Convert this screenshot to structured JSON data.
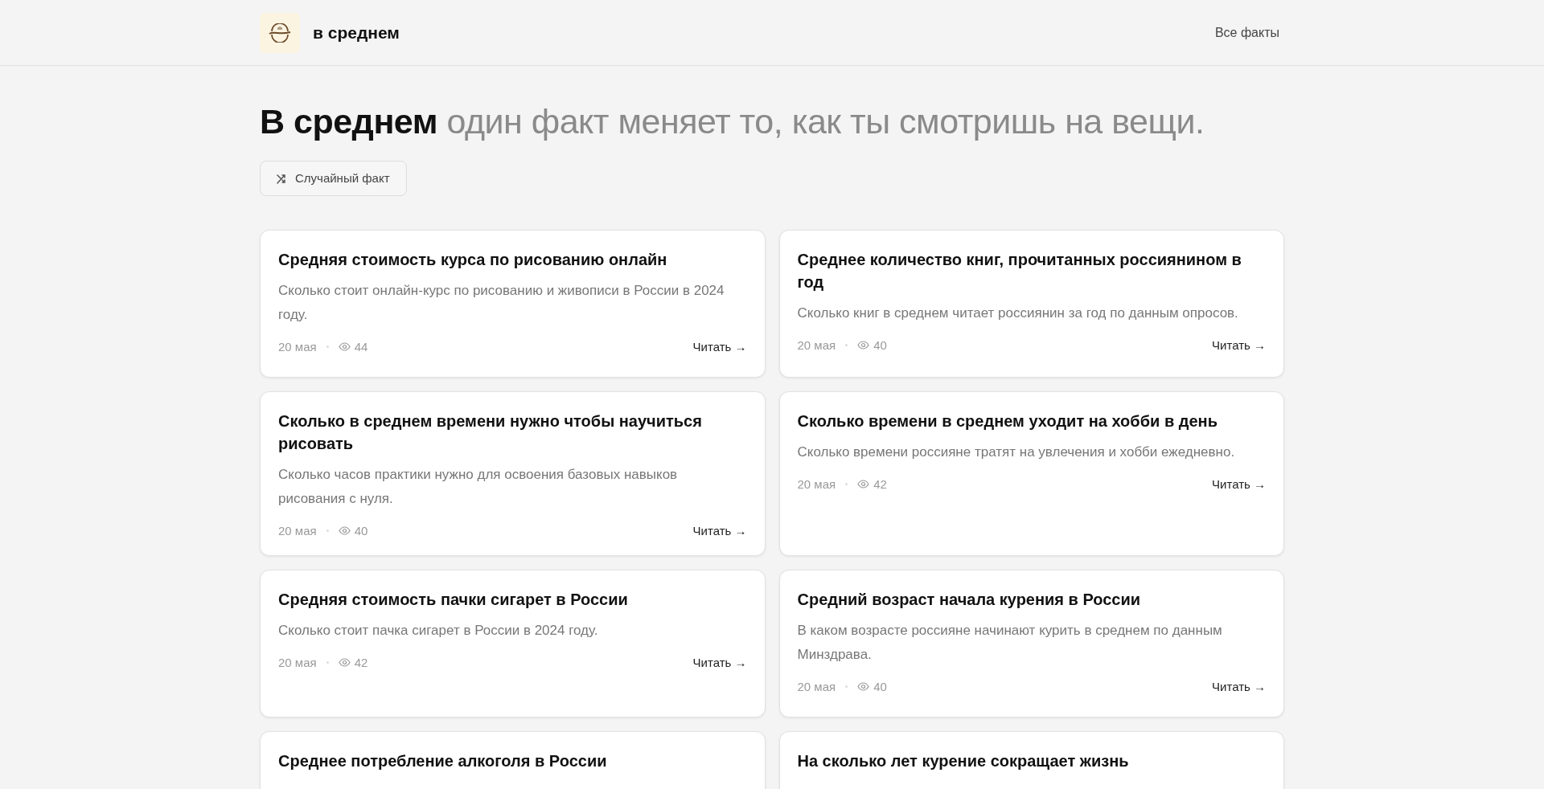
{
  "header": {
    "site_name": "в среднем",
    "nav_link": "Все факты"
  },
  "hero": {
    "title_bold": "В среднем",
    "title_rest": "один факт меняет то, как ты смотришь на вещи.",
    "random_button": "Случайный факт"
  },
  "cards": [
    {
      "title": "Средняя стоимость курса по рисованию онлайн",
      "description": "Сколько стоит онлайн-курс по рисованию и живописи в России в 2024 году.",
      "date": "20 мая",
      "views": "44",
      "read_link": "Читать →"
    },
    {
      "title": "Среднее количество книг, прочитанных россиянином в год",
      "description": "Сколько книг в среднем читает россиянин за год по данным опросов.",
      "date": "20 мая",
      "views": "40",
      "read_link": "Читать →"
    },
    {
      "title": "Сколько в среднем времени нужно чтобы научиться рисовать",
      "description": "Сколько часов практики нужно для освоения базовых навыков рисования с нуля.",
      "date": "20 мая",
      "views": "40",
      "read_link": "Читать →"
    },
    {
      "title": "Сколько времени в среднем уходит на хобби в день",
      "description": "Сколько времени россияне тратят на увлечения и хобби ежедневно.",
      "date": "20 мая",
      "views": "42",
      "read_link": "Читать →"
    },
    {
      "title": "Средняя стоимость пачки сигарет в России",
      "description": "Сколько стоит пачка сигарет в России в 2024 году.",
      "date": "20 мая",
      "views": "42",
      "read_link": "Читать →"
    },
    {
      "title": "Средний возраст начала курения в России",
      "description": "В каком возрасте россияне начинают курить в среднем по данным Минздрава.",
      "date": "20 мая",
      "views": "40",
      "read_link": "Читать →"
    },
    {
      "title": "Среднее потребление алкоголя в России"
    },
    {
      "title": "На сколько лет курение сокращает жизнь"
    }
  ]
}
